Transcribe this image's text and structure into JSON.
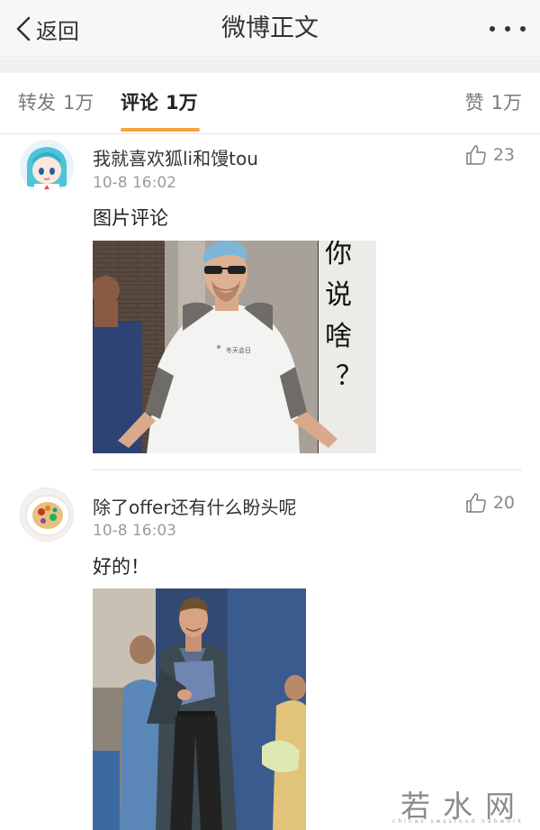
{
  "navbar": {
    "back_label": "返回",
    "title": "微博正文",
    "more_icon": "more-dots-icon"
  },
  "tabs": {
    "repost": {
      "label": "转发",
      "count": "1万"
    },
    "comment": {
      "label": "评论",
      "count": "1万"
    },
    "like": {
      "label": "赞",
      "count": "1万"
    },
    "active_color": "#f7a239"
  },
  "comments": [
    {
      "username": "我就喜欢狐li和馒tou",
      "time": "10-8 16:02",
      "text": "图片评论",
      "likes": "23",
      "avatar_icon": "anime-girl-avatar",
      "image_text": [
        "你",
        "说",
        "啥",
        "？"
      ],
      "shirt_text": "冬天会日"
    },
    {
      "username": "除了offer还有什么盼头呢",
      "time": "10-8 16:03",
      "text": "好的！",
      "likes": "20",
      "avatar_icon": "food-plate-avatar"
    }
  ],
  "watermark": {
    "text": "若水网",
    "sub": "chinas  swsstoud  nebwork"
  }
}
